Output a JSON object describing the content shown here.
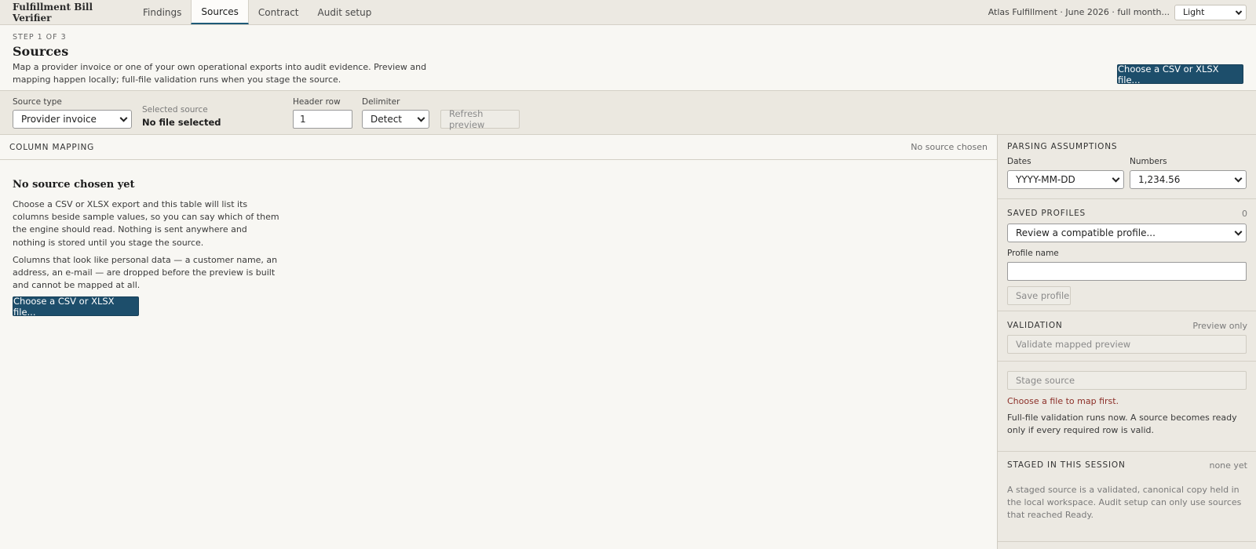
{
  "app": {
    "title": "Fulfillment Bill Verifier",
    "tabs": [
      {
        "label": "Findings",
        "active": false
      },
      {
        "label": "Sources",
        "active": true
      },
      {
        "label": "Contract",
        "active": false
      },
      {
        "label": "Audit setup",
        "active": false
      }
    ],
    "context": "Atlas Fulfillment · June 2026 · full month...",
    "theme": "Light"
  },
  "header": {
    "step": "STEP 1 OF 3",
    "title": "Sources",
    "description": "Map a provider invoice or one of your own operational exports into audit evidence. Preview and mapping happen locally; full-file validation runs when you stage the source.",
    "choose_button": "Choose a CSV or XLSX file..."
  },
  "toolbar": {
    "source_type_label": "Source type",
    "source_type_value": "Provider invoice",
    "selected_source_label": "Selected source",
    "selected_source_value": "No file selected",
    "header_row_label": "Header row",
    "header_row_value": "1",
    "delimiter_label": "Delimiter",
    "delimiter_value": "Detect",
    "refresh_button": "Refresh preview"
  },
  "mapping": {
    "title": "COLUMN MAPPING",
    "status": "No source chosen",
    "empty_title": "No source chosen yet",
    "empty_p1": "Choose a CSV or XLSX export and this table will list its columns beside sample values, so you can say which of them the engine should read. Nothing is sent anywhere and nothing is stored until you stage the source.",
    "empty_p2": "Columns that look like personal data — a customer name, an address, an e-mail — are dropped before the preview is built and cannot be mapped at all.",
    "choose_button": "Choose a CSV or XLSX file..."
  },
  "sidebar": {
    "parsing": {
      "title": "PARSING ASSUMPTIONS",
      "dates_label": "Dates",
      "dates_value": "YYYY-MM-DD",
      "numbers_label": "Numbers",
      "numbers_value": "1,234.56"
    },
    "profiles": {
      "title": "SAVED PROFILES",
      "count": "0",
      "select_value": "Review a compatible profile...",
      "name_label": "Profile name",
      "name_value": "",
      "save_button": "Save profile"
    },
    "validation": {
      "title": "VALIDATION",
      "status": "Preview only",
      "validate_button": "Validate mapped preview",
      "stage_button": "Stage source",
      "warning": "Choose a file to map first.",
      "note": "Full-file validation runs now. A source becomes ready only if every required row is valid."
    },
    "staged": {
      "title": "STAGED IN THIS SESSION",
      "status": "none yet",
      "note": "A staged source is a validated, canonical copy held in the local workspace. Audit setup can only use sources that reached Ready."
    }
  },
  "colors": {
    "accent": "#1d4e6b",
    "warning": "#8c2f28",
    "background": "#f8f7f3",
    "panel": "#ece9e2"
  }
}
